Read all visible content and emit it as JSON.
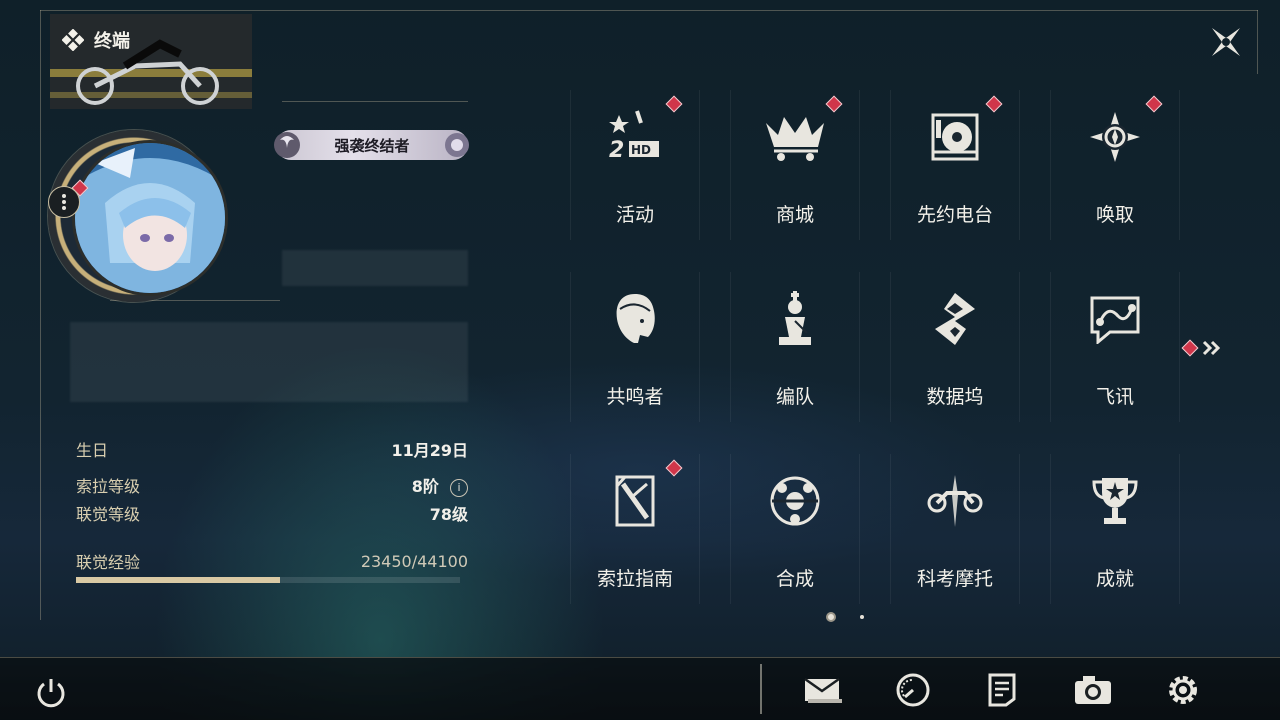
{
  "header": {
    "title": "终端"
  },
  "profile": {
    "title_badge": "强袭终结者",
    "stats": [
      {
        "label": "生日",
        "value": "11月29日"
      },
      {
        "label": "索拉等级",
        "value": "8阶"
      },
      {
        "label": "联觉等级",
        "value": "78级"
      }
    ],
    "exp": {
      "label": "联觉经验",
      "value": "23450/44100",
      "progress": 0.53
    }
  },
  "menu": [
    {
      "label": "活动",
      "icon": "activity-2hd-icon",
      "badge": true
    },
    {
      "label": "商城",
      "icon": "shop-crown-cart-icon",
      "badge": true
    },
    {
      "label": "先约电台",
      "icon": "radio-icon",
      "badge": true
    },
    {
      "label": "唤取",
      "icon": "convene-icon",
      "badge": true
    },
    {
      "label": "共鸣者",
      "icon": "resonator-icon",
      "badge": false
    },
    {
      "label": "编队",
      "icon": "team-chess-icon",
      "badge": false
    },
    {
      "label": "数据坞",
      "icon": "data-bank-icon",
      "badge": false
    },
    {
      "label": "飞讯",
      "icon": "message-icon",
      "badge": false
    },
    {
      "label": "索拉指南",
      "icon": "guidebook-icon",
      "badge": true
    },
    {
      "label": "合成",
      "icon": "synthesis-icon",
      "badge": false
    },
    {
      "label": "科考摩托",
      "icon": "motorcycle-icon",
      "badge": false
    },
    {
      "label": "成就",
      "icon": "trophy-icon",
      "badge": false
    }
  ],
  "pager": {
    "pages": 2,
    "current": 1
  },
  "bottom_icons": [
    "mail-icon",
    "clock-icon",
    "notes-icon",
    "camera-icon",
    "settings-gear-icon"
  ],
  "colors": {
    "accent": "#d9c9a4",
    "badge": "#d0364a",
    "text": "#f3f1ea"
  }
}
